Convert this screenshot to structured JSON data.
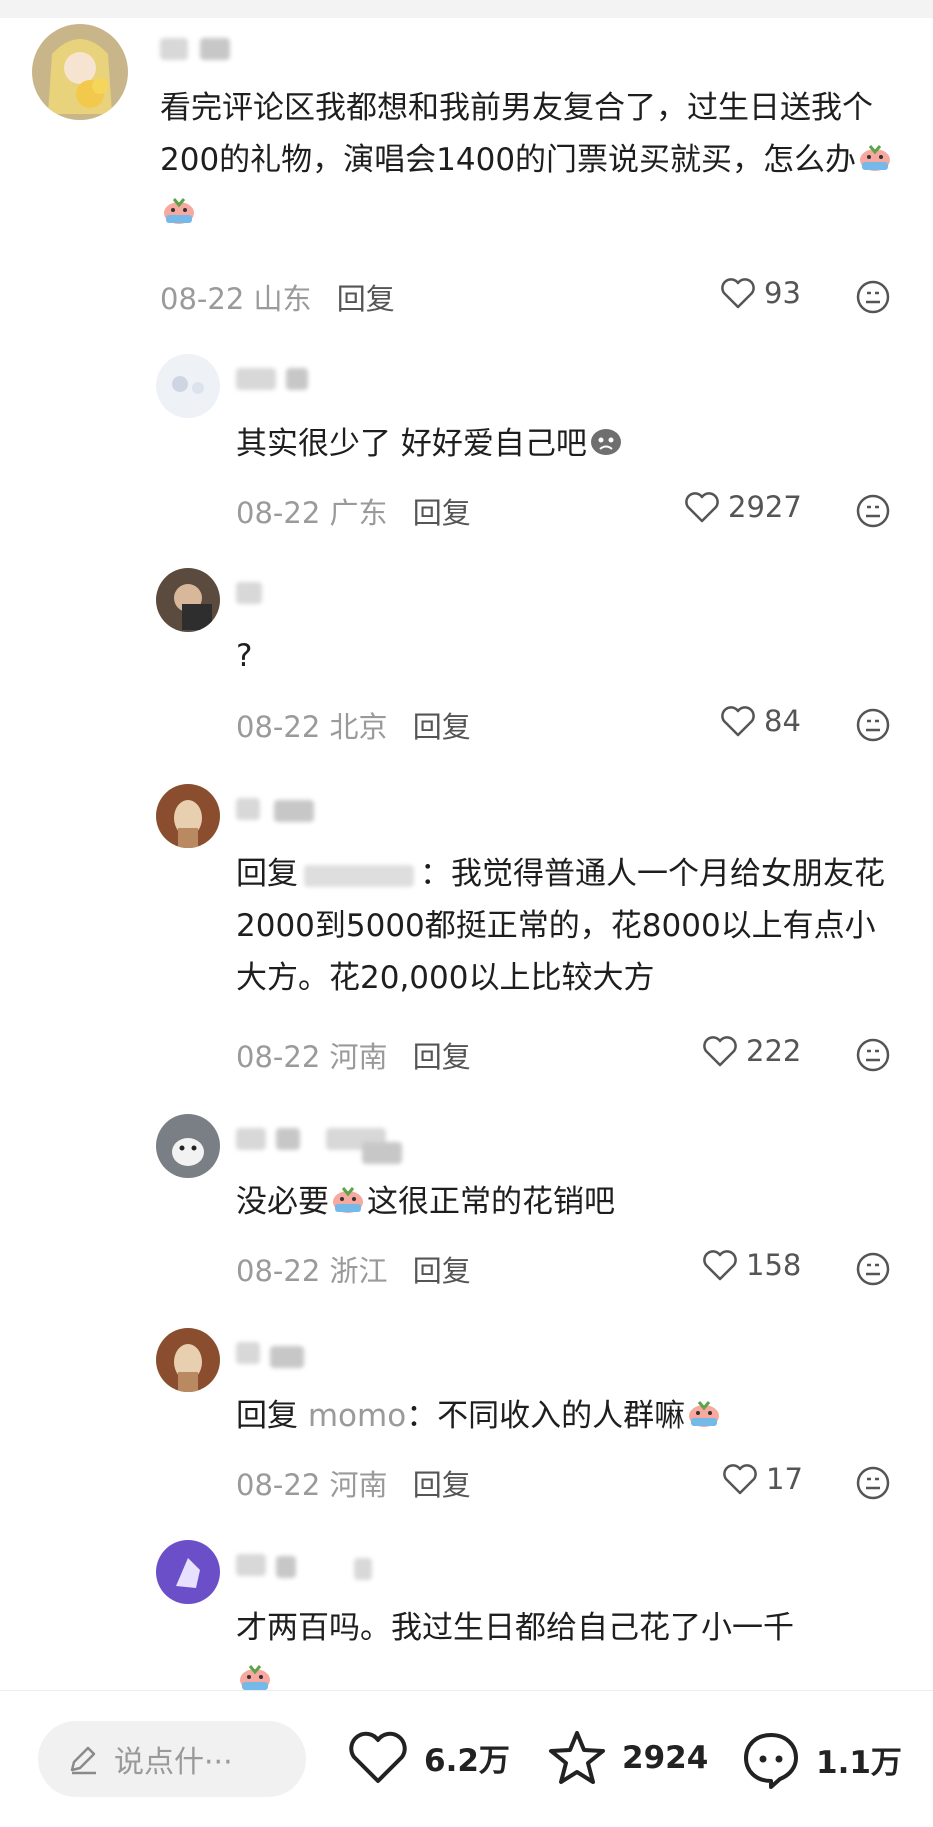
{
  "comments": [
    {
      "text": "看完评论区我都想和我前男友复合了，过生日送我个200的礼物，演唱会1400的门票说买就买，怎么办",
      "date": "08-22",
      "location": "山东",
      "reply_label": "回复",
      "likes": "93",
      "emojis": [
        "crying-emoji",
        "crying-emoji"
      ]
    },
    {
      "text": "其实很少了 好好爱自己吧",
      "date": "08-22",
      "location": "广东",
      "reply_label": "回复",
      "likes": "2927",
      "emojis": [
        "sad-face-emoji"
      ]
    },
    {
      "text": "?",
      "date": "08-22",
      "location": "北京",
      "reply_label": "回复",
      "likes": "84"
    },
    {
      "reply_prefix": "回复",
      "text": "：我觉得普通人一个月给女朋友花2000到5000都挺正常的，花8000以上有点小大方。花20,000以上比较大方",
      "date": "08-22",
      "location": "河南",
      "reply_label": "回复",
      "likes": "222"
    },
    {
      "text_before": "没必要",
      "text_after": "这很正常的花销吧",
      "date": "08-22",
      "location": "浙江",
      "reply_label": "回复",
      "likes": "158",
      "emojis": [
        "crying-emoji"
      ]
    },
    {
      "reply_prefix": "回复",
      "reply_target": "momo",
      "text": "：不同收入的人群嘛",
      "date": "08-22",
      "location": "河南",
      "reply_label": "回复",
      "likes": "17",
      "emojis": [
        "crying-emoji"
      ]
    },
    {
      "text": "才两百吗。我过生日都给自己花了小一千",
      "emojis": [
        "crying-emoji"
      ]
    }
  ],
  "bottom_bar": {
    "input_placeholder": "说点什···",
    "likes": "6.2万",
    "favorites": "2924",
    "comments": "1.1万"
  },
  "colors": {
    "meta_text": "#9a9a9a",
    "body_text": "#1e1e1e"
  }
}
